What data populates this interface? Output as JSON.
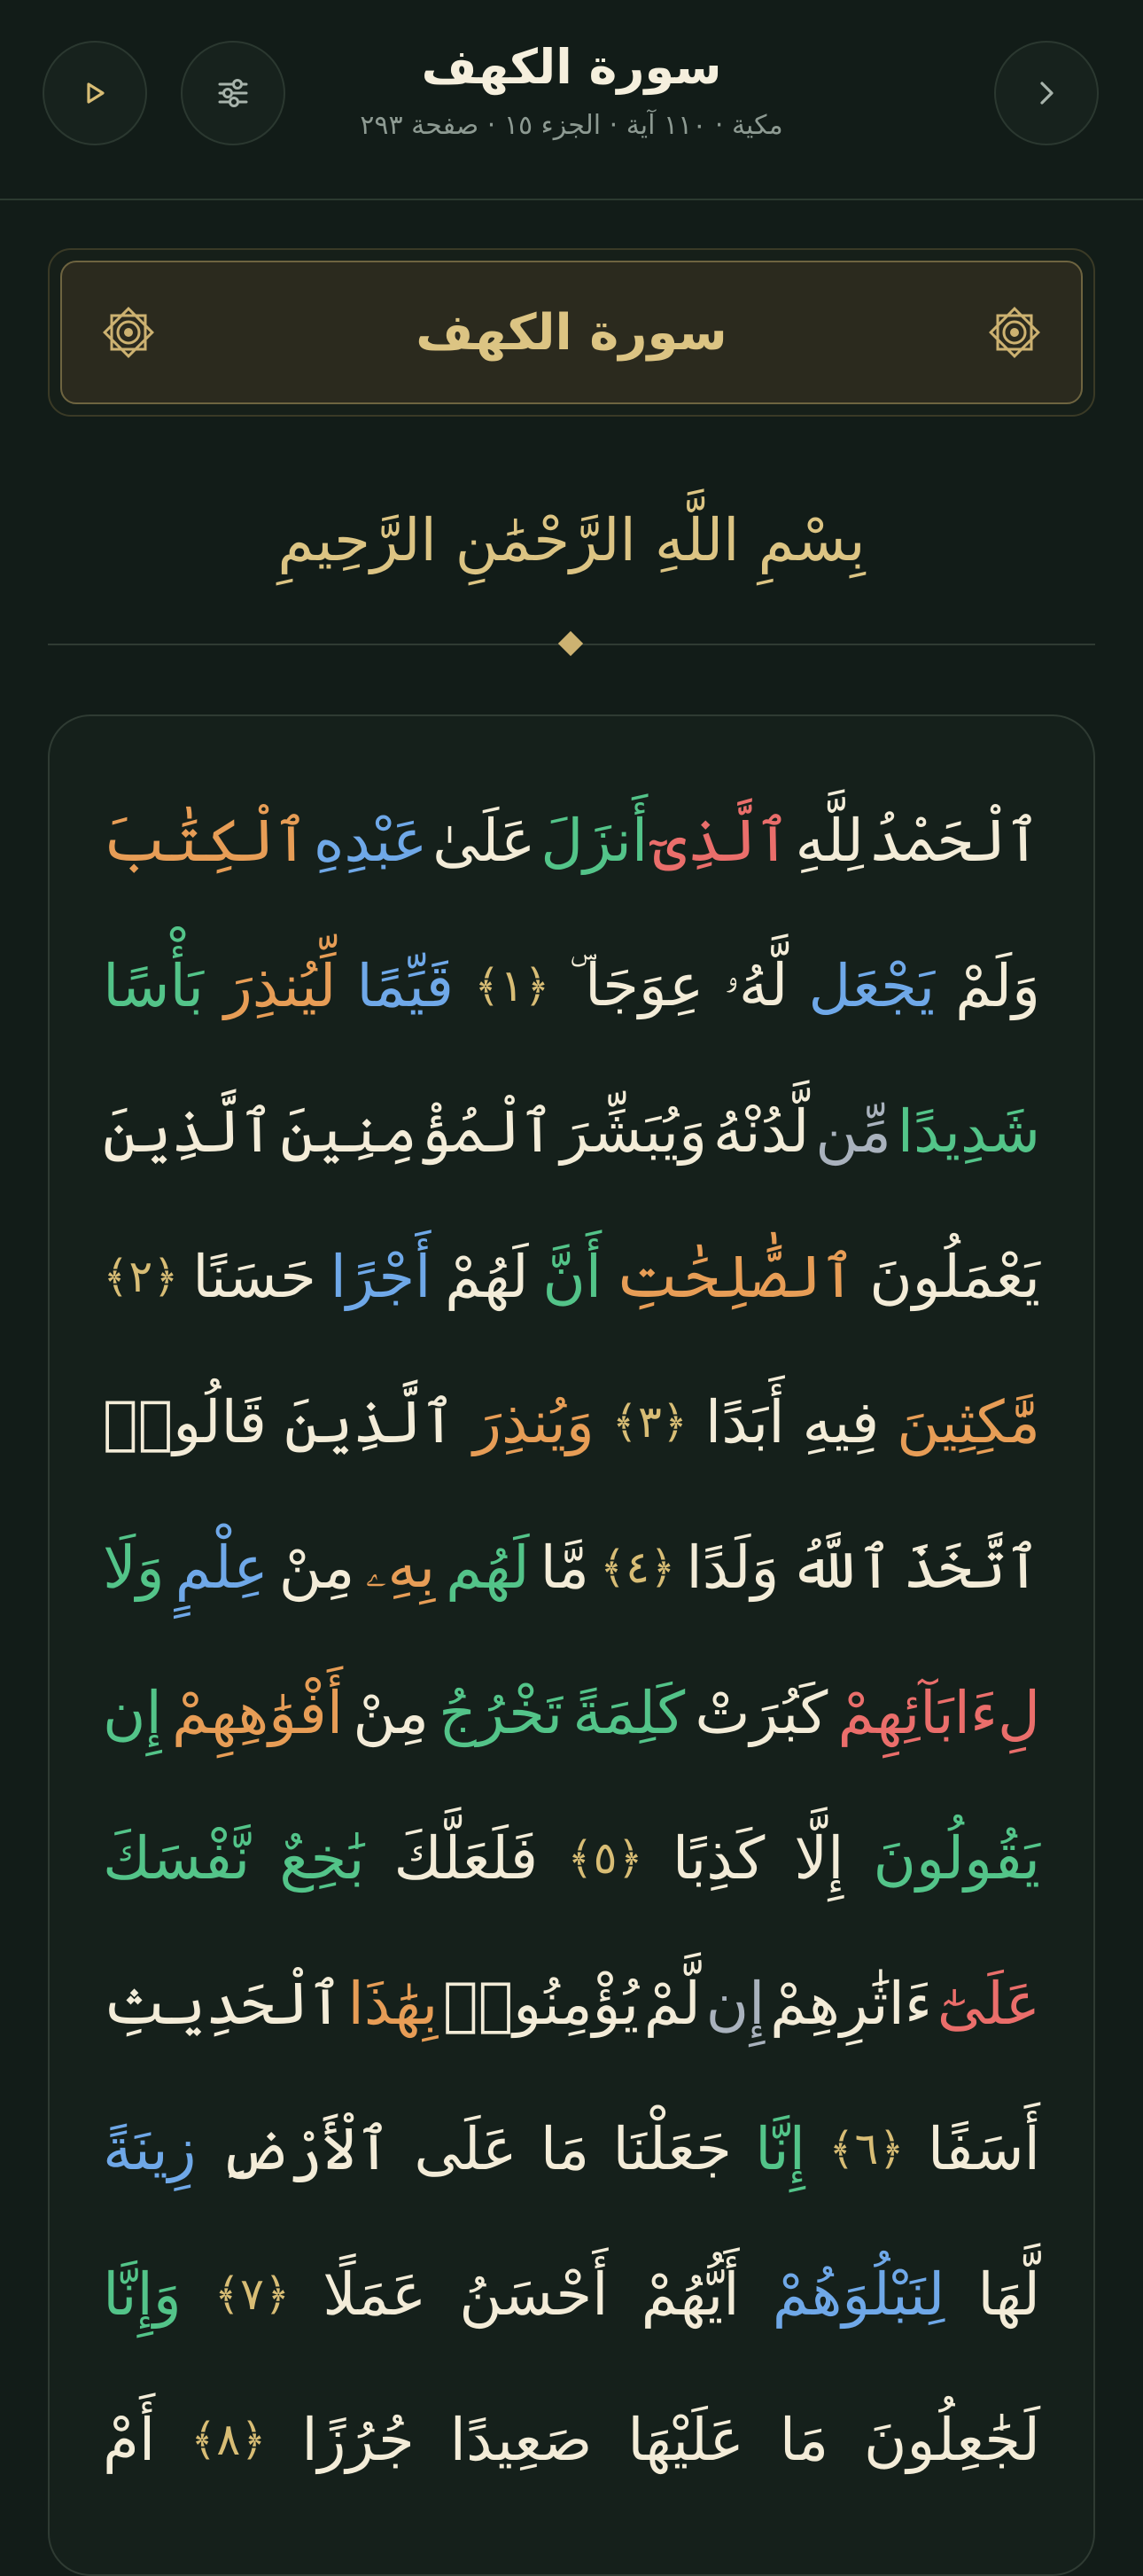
{
  "header": {
    "title": "سورة الكهف",
    "subtitle": "مكية · ١١٠ آية · الجزء ١٥ · صفحة ٢٩٣",
    "back_icon": "chevron-right-icon",
    "settings_icon": "sliders-icon",
    "play_icon": "play-icon"
  },
  "banner": {
    "title": "سورة الكهف",
    "ornament_icon": "rosette-icon"
  },
  "basmala": "بِسْمِ اللَّهِ الرَّحْمَٰنِ الرَّحِيمِ",
  "verses": {
    "lines": [
      {
        "words": [
          {
            "t": "ٱلْحَمْدُ"
          },
          {
            "t": "لِلَّهِ"
          },
          {
            "t": "ٱلَّذِىٓ",
            "color": "#ea6e6b"
          },
          {
            "t": "أَنزَلَ",
            "color": "#53c489"
          },
          {
            "t": "عَلَىٰ"
          },
          {
            "t": "عَبْدِهِ",
            "color": "#6fa8e8"
          },
          {
            "t": "ٱلْكِتَٰبَ",
            "color": "#e79d56"
          }
        ]
      },
      {
        "words": [
          {
            "t": "وَلَمْ"
          },
          {
            "t": "يَجْعَل",
            "color": "#6fa8e8"
          },
          {
            "t": "لَّهُۥ"
          },
          {
            "t": "عِوَجَا ۜ"
          },
          {
            "t": "﴿١﴾",
            "ayah": true
          },
          {
            "t": "قَيِّمًا",
            "color": "#6fa8e8"
          },
          {
            "t": "لِّيُنذِرَ",
            "color": "#e79d56"
          },
          {
            "t": "بَأْسًا",
            "color": "#53c489"
          }
        ]
      },
      {
        "words": [
          {
            "t": "شَدِيدًا",
            "color": "#53c489"
          },
          {
            "t": "مِّن",
            "color": "#a9b2bd"
          },
          {
            "t": "لَّدُنْهُ"
          },
          {
            "t": "وَيُبَشِّرَ"
          },
          {
            "t": "ٱلْمُؤْمِنِينَ"
          },
          {
            "t": "ٱلَّذِينَ"
          }
        ]
      },
      {
        "words": [
          {
            "t": "يَعْمَلُونَ"
          },
          {
            "t": "ٱلصَّٰلِحَٰتِ",
            "color": "#e79d56"
          },
          {
            "t": "أَنَّ",
            "color": "#53c489"
          },
          {
            "t": "لَهُمْ"
          },
          {
            "t": "أَجْرًا",
            "color": "#6fa8e8"
          },
          {
            "t": "حَسَنًا"
          },
          {
            "t": "﴿٢﴾",
            "ayah": true
          }
        ]
      },
      {
        "words": [
          {
            "t": "مَّٰكِثِينَ",
            "color": "#e79d56"
          },
          {
            "t": "فِيهِ"
          },
          {
            "t": "أَبَدًا"
          },
          {
            "t": "﴿٣﴾",
            "ayah": true
          },
          {
            "t": "وَيُنذِرَ",
            "color": "#e79d56"
          },
          {
            "t": "ٱلَّذِينَ"
          },
          {
            "t": "قَالُوا۟"
          }
        ]
      },
      {
        "words": [
          {
            "t": "ٱتَّخَذَ"
          },
          {
            "t": "ٱللَّهُ"
          },
          {
            "t": "وَلَدًا"
          },
          {
            "t": "﴿٤﴾",
            "ayah": true
          },
          {
            "t": "مَّا"
          },
          {
            "t": "لَهُم",
            "color": "#53c489"
          },
          {
            "t": "بِهِۦ",
            "color": "#e79d56"
          },
          {
            "t": "مِنْ"
          },
          {
            "t": "عِلْمٍ",
            "color": "#6fa8e8"
          },
          {
            "t": "وَلَا",
            "color": "#53c489"
          }
        ]
      },
      {
        "words": [
          {
            "t": "لِءَابَآئِهِمْ",
            "color": "#ea6e6b"
          },
          {
            "t": "كَبُرَتْ"
          },
          {
            "t": "كَلِمَةً",
            "color": "#53c489"
          },
          {
            "t": "تَخْرُجُ",
            "color": "#53c489"
          },
          {
            "t": "مِنْ"
          },
          {
            "t": "أَفْوَٰهِهِمْ",
            "color": "#e79d56"
          },
          {
            "t": "إِن",
            "color": "#53c489"
          }
        ]
      },
      {
        "words": [
          {
            "t": "يَقُولُونَ",
            "color": "#53c489"
          },
          {
            "t": "إِلَّا"
          },
          {
            "t": "كَذِبًا"
          },
          {
            "t": "﴿٥﴾",
            "ayah": true
          },
          {
            "t": "فَلَعَلَّكَ"
          },
          {
            "t": "بَٰخِعٌ",
            "color": "#53c489"
          },
          {
            "t": "نَّفْسَكَ",
            "color": "#53c489"
          }
        ]
      },
      {
        "words": [
          {
            "t": "عَلَىٰٓ",
            "color": "#ea6e6b"
          },
          {
            "t": "ءَاثَٰرِهِمْ"
          },
          {
            "t": "إِن",
            "color": "#a9b2bd"
          },
          {
            "t": "لَّمْ"
          },
          {
            "t": "يُؤْمِنُوا۟"
          },
          {
            "t": "بِهَٰذَا",
            "color": "#e79d56"
          },
          {
            "t": "ٱلْحَدِيثِ"
          }
        ]
      },
      {
        "words": [
          {
            "t": "أَسَفًا"
          },
          {
            "t": "﴿٦﴾",
            "ayah": true
          },
          {
            "t": "إِنَّا",
            "color": "#53c489"
          },
          {
            "t": "جَعَلْنَا"
          },
          {
            "t": "مَا"
          },
          {
            "t": "عَلَى"
          },
          {
            "t": "ٱلْأَرْضِ"
          },
          {
            "t": "زِينَةً",
            "color": "#6fa8e8"
          }
        ]
      },
      {
        "words": [
          {
            "t": "لَّهَا"
          },
          {
            "t": "لِنَبْلُوَهُمْ",
            "color": "#6fa8e8"
          },
          {
            "t": "أَيُّهُمْ"
          },
          {
            "t": "أَحْسَنُ"
          },
          {
            "t": "عَمَلًا"
          },
          {
            "t": "﴿٧﴾",
            "ayah": true
          },
          {
            "t": "وَإِنَّا",
            "color": "#53c489"
          }
        ]
      },
      {
        "words": [
          {
            "t": "لَجَٰعِلُونَ"
          },
          {
            "t": "مَا"
          },
          {
            "t": "عَلَيْهَا"
          },
          {
            "t": "صَعِيدًا"
          },
          {
            "t": "جُرُزًا"
          },
          {
            "t": "﴿٨﴾",
            "ayah": true
          },
          {
            "t": "أَمْ"
          }
        ]
      }
    ]
  }
}
